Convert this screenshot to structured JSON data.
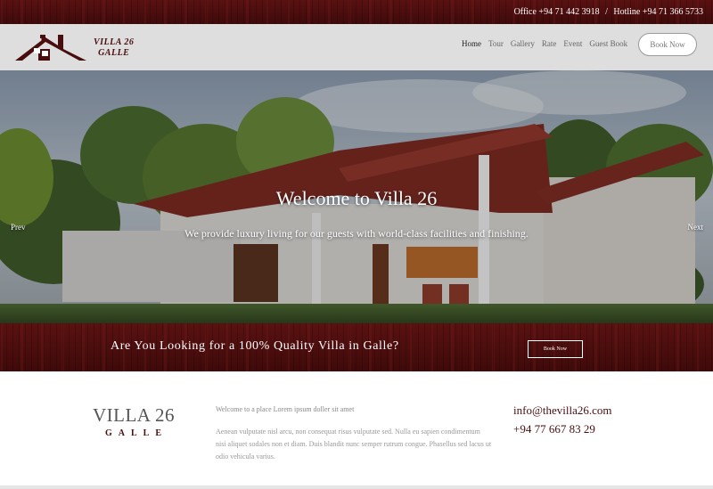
{
  "colors": {
    "brand": "#4a0d0d",
    "navbar_bg": "#dedede",
    "text_muted": "#999999"
  },
  "topbar": {
    "office": "Office +94 71 442 3918",
    "separator": "/",
    "hotline": "Hotline +94 71 366 5733"
  },
  "header": {
    "logo_icon": "house-icon",
    "brand_line1": "VILLA 26",
    "brand_line2": "GALLE",
    "nav": [
      {
        "label": "Home",
        "active": true
      },
      {
        "label": "Tour"
      },
      {
        "label": "Gallery"
      },
      {
        "label": "Rate"
      },
      {
        "label": "Event"
      },
      {
        "label": "Guest Book"
      }
    ],
    "book_now": "Book Now"
  },
  "hero": {
    "title": "Welcome to Villa 26",
    "tagline": "We provide luxury living for our guests with world-class facilities and finishing.",
    "prev": "Prev",
    "next": "Next"
  },
  "cta": {
    "question": "Are You Looking for a 100% Quality Villa in Galle?",
    "button": "Book Now"
  },
  "footer": {
    "logo_name": "VILLA 26",
    "logo_city": "GALLE",
    "intro": "Welcome to a place Lorem ipsum doller sit amet",
    "body": "Aenean vulputate nisl arcu, non consequat risus vulputate sed. Nulla eu sapien condimentum nisi aliquet sodales non et diam. Duis blandit nunc semper rutrum congue. Phasellus sed lacus ut odio vehicula varius.",
    "email": "info@thevilla26.com",
    "phone": "+94 77 667 83 29"
  }
}
